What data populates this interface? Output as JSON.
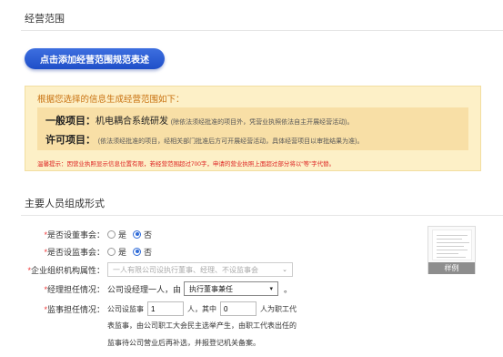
{
  "business_scope": {
    "section_title": "经营范围",
    "add_button_label": "点击添加经营范围规范表述",
    "notice": {
      "heading": "根据您选择的信息生成经营范围如下：",
      "general_label": "一般项目：",
      "general_value": "机电耦合系统研发",
      "general_note": "(除依法须经批准的项目外，凭营业执照依法自主开展经营活动)。",
      "licensed_label": "许可项目：",
      "licensed_note": "(依法须经批准的项目，经相关部门批准后方可开展经营活动，具体经营项目以审批结果为准)。",
      "warning": "温馨提示：因营业执照显示信息位置有限，若经营范围超过700字，申请的营业执照上面超过部分将以“等”字代替。"
    }
  },
  "personnel": {
    "section_title": "主要人员组成形式",
    "board_label": "是否设董事会：",
    "board_options": [
      "是",
      "否"
    ],
    "board_selected": "否",
    "supervisors_label": "是否设监事会：",
    "supervisors_options": [
      "是",
      "否"
    ],
    "supervisors_selected": "否",
    "org_structure_label": "企业组织机构属性：",
    "org_structure_placeholder": "一人有限公司设执行董事、经理、不设监事会",
    "manager_label": "经理担任情况：",
    "manager_prefix": "公司设经理一人，由",
    "manager_select": "执行董事兼任",
    "manager_suffix": "。",
    "supervisor_label": "监事担任情况：",
    "supervisor_prefix": "公司设监事",
    "supervisor_count": "1",
    "supervisor_mid": "人，其中",
    "employee_rep_count": "0",
    "supervisor_suffix": "人为职工代",
    "supervisor_line2": "表监事，由公司职工大会民主选举产生，由职工代表出任的",
    "supervisor_line3": "监事待公司营业后再补选，并报登记机关备案。",
    "sample_label": "样例"
  },
  "colors": {
    "accent": "#2f6bd8",
    "notice_bg": "#fdf0c7",
    "notice_head": "#c8700e",
    "warning": "#dd2222"
  }
}
